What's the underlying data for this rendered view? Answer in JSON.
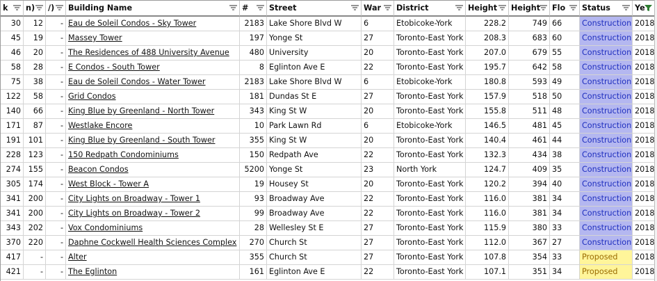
{
  "columns": [
    {
      "key": "c1",
      "label": "k"
    },
    {
      "key": "c2",
      "label": "n)"
    },
    {
      "key": "c3",
      "label": "/)"
    },
    {
      "key": "name",
      "label": "Building Name"
    },
    {
      "key": "num",
      "label": "#"
    },
    {
      "key": "street",
      "label": "Street"
    },
    {
      "key": "ward",
      "label": "War"
    },
    {
      "key": "district",
      "label": "District"
    },
    {
      "key": "hm",
      "label": "Height"
    },
    {
      "key": "hf",
      "label": "Height"
    },
    {
      "key": "floors",
      "label": "Flo"
    },
    {
      "key": "status",
      "label": "Status"
    },
    {
      "key": "year",
      "label": "Ye"
    }
  ],
  "rows": [
    [
      "30",
      "12",
      "-",
      "Eau de Soleil Condos - Sky Tower",
      "2183",
      "Lake Shore Blvd W",
      "6",
      "Etobicoke-York",
      "228.2",
      "749",
      "66",
      "Construction",
      "2018"
    ],
    [
      "45",
      "19",
      "-",
      "Massey Tower",
      "197",
      "Yonge St",
      "27",
      "Toronto-East York",
      "208.3",
      "683",
      "60",
      "Construction",
      "2018"
    ],
    [
      "46",
      "20",
      "-",
      "The Residences of 488 University Avenue",
      "480",
      "University",
      "20",
      "Toronto-East York",
      "207.0",
      "679",
      "55",
      "Construction",
      "2018"
    ],
    [
      "58",
      "28",
      "-",
      "E Condos - South Tower",
      "8",
      "Eglinton Ave E",
      "22",
      "Toronto-East York",
      "195.7",
      "642",
      "58",
      "Construction",
      "2018"
    ],
    [
      "75",
      "38",
      "-",
      "Eau de Soleil Condos - Water Tower",
      "2183",
      "Lake Shore Blvd W",
      "6",
      "Etobicoke-York",
      "180.8",
      "593",
      "49",
      "Construction",
      "2018"
    ],
    [
      "122",
      "58",
      "-",
      "Grid Condos",
      "181",
      "Dundas St E",
      "27",
      "Toronto-East York",
      "157.9",
      "518",
      "50",
      "Construction",
      "2018"
    ],
    [
      "140",
      "66",
      "-",
      "King Blue by Greenland - North Tower",
      "343",
      "King St W",
      "20",
      "Toronto-East York",
      "155.8",
      "511",
      "48",
      "Construction",
      "2018"
    ],
    [
      "171",
      "87",
      "-",
      "Westlake Encore",
      "10",
      "Park Lawn Rd",
      "6",
      "Etobicoke-York",
      "146.5",
      "481",
      "45",
      "Construction",
      "2018"
    ],
    [
      "191",
      "101",
      "-",
      "King Blue by Greenland - South Tower",
      "355",
      "King St W",
      "20",
      "Toronto-East York",
      "140.4",
      "461",
      "44",
      "Construction",
      "2018"
    ],
    [
      "228",
      "123",
      "-",
      "150 Redpath Condominiums",
      "150",
      "Redpath Ave",
      "22",
      "Toronto-East York",
      "132.3",
      "434",
      "38",
      "Construction",
      "2018"
    ],
    [
      "274",
      "155",
      "-",
      "Beacon Condos",
      "5200",
      "Yonge St",
      "23",
      "North York",
      "124.7",
      "409",
      "35",
      "Construction",
      "2018"
    ],
    [
      "305",
      "174",
      "-",
      "West Block - Tower A",
      "19",
      "Housey St",
      "20",
      "Toronto-East York",
      "120.2",
      "394",
      "40",
      "Construction",
      "2018"
    ],
    [
      "341",
      "200",
      "-",
      "City Lights on Broadway - Tower 1",
      "93",
      "Broadway Ave",
      "22",
      "Toronto-East York",
      "116.0",
      "381",
      "34",
      "Construction",
      "2018"
    ],
    [
      "341",
      "200",
      "-",
      "City Lights on Broadway - Tower 2",
      "99",
      "Broadway Ave",
      "22",
      "Toronto-East York",
      "116.0",
      "381",
      "34",
      "Construction",
      "2018"
    ],
    [
      "343",
      "202",
      "-",
      "Vox Condominiums",
      "28",
      "Wellesley St E",
      "27",
      "Toronto-East York",
      "115.9",
      "380",
      "33",
      "Construction",
      "2018"
    ],
    [
      "370",
      "220",
      "-",
      "Daphne Cockwell Health Sciences Complex",
      "270",
      "Church St",
      "27",
      "Toronto-East York",
      "112.0",
      "367",
      "27",
      "Construction",
      "2018"
    ],
    [
      "417",
      "-",
      "-",
      "Alter",
      "355",
      "Church St",
      "27",
      "Toronto-East York",
      "107.8",
      "354",
      "33",
      "Proposed",
      "2018"
    ],
    [
      "421",
      "-",
      "-",
      "The Eglinton",
      "161",
      "Eglinton Ave E",
      "22",
      "Toronto-East York",
      "107.1",
      "351",
      "34",
      "Proposed",
      "2018"
    ]
  ],
  "colors": {
    "construction_bg": "#b4b7f0",
    "proposed_bg": "#fff59a",
    "filter_active": "#2e7d32"
  },
  "icons": {
    "filter": "filter-dropdown-icon",
    "filter_active": "filter-active-icon"
  }
}
